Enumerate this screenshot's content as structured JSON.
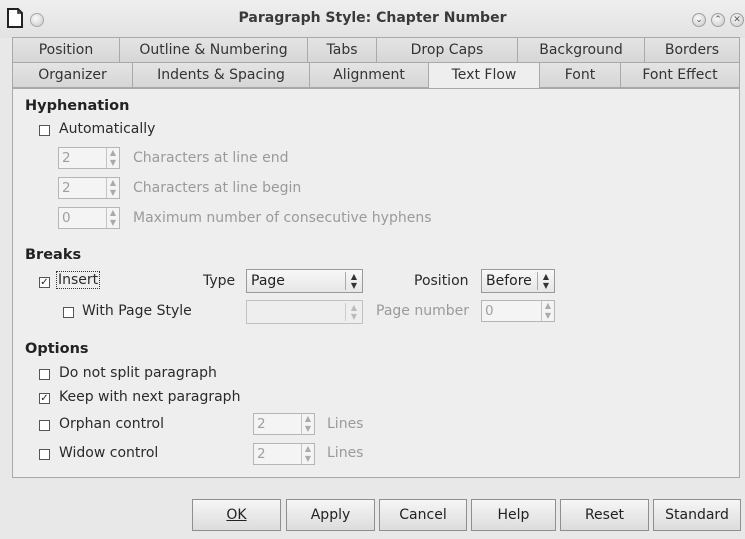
{
  "window": {
    "title": "Paragraph Style: Chapter Number",
    "controls": [
      "minimize-icon",
      "maximize-icon",
      "close-icon"
    ]
  },
  "tabs_row1": [
    "Position",
    "Outline & Numbering",
    "Tabs",
    "Drop Caps",
    "Background",
    "Borders"
  ],
  "tabs_row2": [
    "Organizer",
    "Indents & Spacing",
    "Alignment",
    "Text Flow",
    "Font",
    "Font Effect"
  ],
  "active_tab": "Text Flow",
  "hyphenation": {
    "heading": "Hyphenation",
    "automatically_label": "Automatically",
    "automatically_checked": false,
    "line_end_value": "2",
    "line_end_label": "Characters at line end",
    "line_begin_value": "2",
    "line_begin_label": "Characters at line begin",
    "max_hyphens_value": "0",
    "max_hyphens_label": "Maximum number of consecutive hyphens"
  },
  "breaks": {
    "heading": "Breaks",
    "insert_label": "Insert",
    "insert_checked": true,
    "type_label": "Type",
    "type_value": "Page",
    "position_label": "Position",
    "position_value": "Before",
    "page_style_label": "With Page Style",
    "page_style_checked": false,
    "page_style_value": "",
    "page_number_label": "Page number",
    "page_number_value": "0"
  },
  "options": {
    "heading": "Options",
    "no_split_label": "Do not split paragraph",
    "no_split_checked": false,
    "keep_next_label": "Keep with next paragraph",
    "keep_next_checked": true,
    "orphan_label": "Orphan control",
    "orphan_checked": false,
    "orphan_value": "2",
    "orphan_unit": "Lines",
    "widow_label": "Widow control",
    "widow_checked": false,
    "widow_value": "2",
    "widow_unit": "Lines"
  },
  "buttons": {
    "ok": "OK",
    "apply": "Apply",
    "cancel": "Cancel",
    "help": "Help",
    "reset": "Reset",
    "standard": "Standard"
  }
}
